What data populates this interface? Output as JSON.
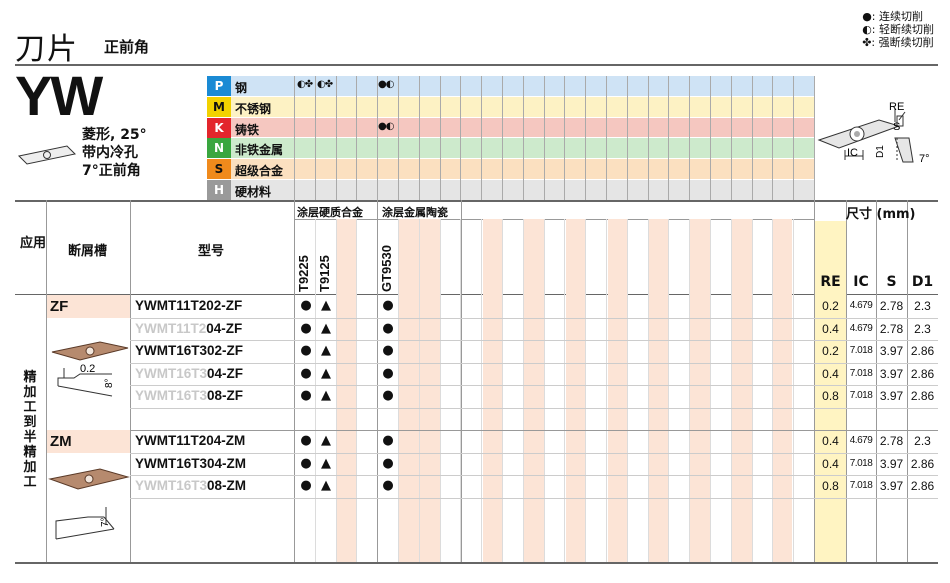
{
  "header": {
    "title": "刀片",
    "subtitle": "正前角"
  },
  "legend": [
    {
      "symbol": "●",
      "text": ": 连续切削"
    },
    {
      "symbol": "◐",
      "text": ": 轻断续切削"
    },
    {
      "symbol": "✤",
      "text": ": 强断续切削"
    }
  ],
  "insert": {
    "code": "YW",
    "desc1": "菱形, 25°",
    "desc2": "带内冷孔",
    "desc3": "7°正前角"
  },
  "materials": [
    {
      "letter": "P",
      "name": "钢",
      "color": "#cfe3f5",
      "letter_bg": "#1a8ad4",
      "mark_col1": "◐✤",
      "mark_col2": "◐✤",
      "mark_gt": "●◐"
    },
    {
      "letter": "M",
      "name": "不锈钢",
      "color": "#fdf2c4",
      "letter_bg": "#f2d100",
      "mark_col1": "",
      "mark_col2": "",
      "mark_gt": ""
    },
    {
      "letter": "K",
      "name": "铸铁",
      "color": "#f5c7c0",
      "letter_bg": "#e3262c",
      "mark_col1": "",
      "mark_col2": "",
      "mark_gt": "●◐"
    },
    {
      "letter": "N",
      "name": "非铁金属",
      "color": "#cdeacc",
      "letter_bg": "#3aa63f",
      "mark_col1": "",
      "mark_col2": "",
      "mark_gt": ""
    },
    {
      "letter": "S",
      "name": "超级合金",
      "color": "#fbe0c0",
      "letter_bg": "#f08a1c",
      "mark_col1": "",
      "mark_col2": "",
      "mark_gt": ""
    },
    {
      "letter": "H",
      "name": "硬材料",
      "color": "#e5e5e5",
      "letter_bg": "#9a9a9a",
      "mark_col1": "",
      "mark_col2": "",
      "mark_gt": ""
    }
  ],
  "table": {
    "app_label": "应用",
    "chipbreaker_label": "断屑槽",
    "model_label": "型号",
    "coated_carbide": "涂层硬质合金",
    "coated_cermet": "涂层金属陶瓷",
    "grades": [
      "T9225",
      "T9125",
      "GT9530"
    ],
    "size_label": "尺寸 (mm)",
    "size_cols": [
      "RE",
      "IC",
      "S",
      "D1"
    ],
    "app_vertical": "精加工到半精加工",
    "groups": [
      {
        "name": "ZF",
        "dim1": "0.2",
        "angle1": "8°",
        "rows": [
          {
            "prefix": "YWMT11T202-ZF",
            "faded": "",
            "rest": "",
            "g1": "●",
            "g2": "▲",
            "g3": "●",
            "RE": "0.2",
            "IC": "4.679",
            "S": "2.78",
            "D1": "2.3"
          },
          {
            "prefix": "",
            "faded": "YWMT11T2",
            "rest": "04-ZF",
            "g1": "●",
            "g2": "▲",
            "g3": "●",
            "RE": "0.4",
            "IC": "4.679",
            "S": "2.78",
            "D1": "2.3"
          },
          {
            "prefix": "YWMT16T302-ZF",
            "faded": "",
            "rest": "",
            "g1": "●",
            "g2": "▲",
            "g3": "●",
            "RE": "0.2",
            "IC": "7.018",
            "S": "3.97",
            "D1": "2.86"
          },
          {
            "prefix": "",
            "faded": "YWMT16T3",
            "rest": "04-ZF",
            "g1": "●",
            "g2": "▲",
            "g3": "●",
            "RE": "0.4",
            "IC": "7.018",
            "S": "3.97",
            "D1": "2.86"
          },
          {
            "prefix": "",
            "faded": "YWMT16T3",
            "rest": "08-ZF",
            "g1": "●",
            "g2": "▲",
            "g3": "●",
            "RE": "0.8",
            "IC": "7.018",
            "S": "3.97",
            "D1": "2.86"
          }
        ]
      },
      {
        "name": "ZM",
        "angle1": "7°",
        "rows": [
          {
            "prefix": "YWMT11T204-ZM",
            "faded": "",
            "rest": "",
            "g1": "●",
            "g2": "▲",
            "g3": "●",
            "RE": "0.4",
            "IC": "4.679",
            "S": "2.78",
            "D1": "2.3"
          },
          {
            "prefix": "YWMT16T304-ZM",
            "faded": "",
            "rest": "",
            "g1": "●",
            "g2": "▲",
            "g3": "●",
            "RE": "0.4",
            "IC": "7.018",
            "S": "3.97",
            "D1": "2.86"
          },
          {
            "prefix": "",
            "faded": "YWMT16T3",
            "rest": "08-ZM",
            "g1": "●",
            "g2": "▲",
            "g3": "●",
            "RE": "0.8",
            "IC": "7.018",
            "S": "3.97",
            "D1": "2.86"
          }
        ]
      }
    ]
  },
  "diagram": {
    "re": "RE",
    "s": "S",
    "ic": "IC",
    "d1": "D1",
    "angle": "7°"
  }
}
